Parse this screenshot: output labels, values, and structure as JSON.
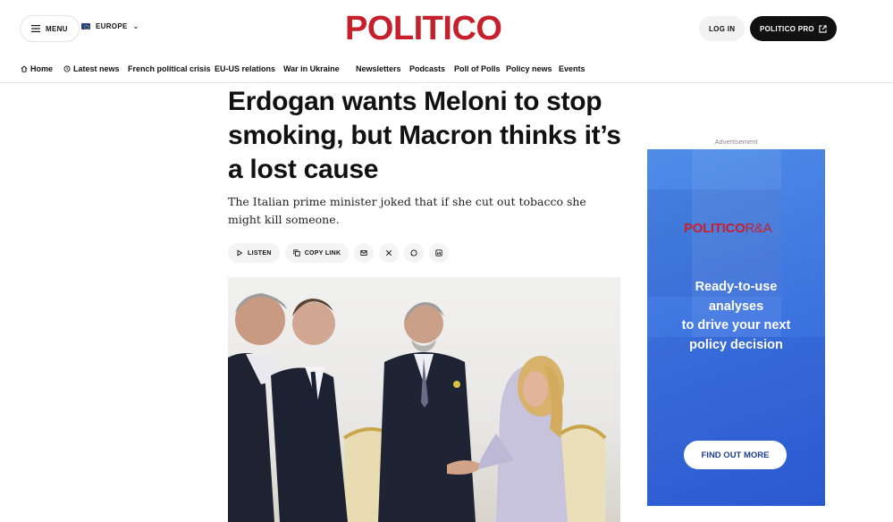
{
  "header": {
    "menu_label": "MENU",
    "region_label": "EUROPE",
    "logo_text": "POLITICO",
    "login_label": "LOG IN",
    "pro_label": "POLITICO PRO",
    "brand_color": "#c6202d"
  },
  "nav": {
    "items": [
      {
        "label": "Home",
        "icon": "home-icon"
      },
      {
        "label": "Latest news",
        "icon": "clock-icon"
      },
      {
        "label": "French political crisis"
      },
      {
        "label": "EU-US relations"
      },
      {
        "label": "War in Ukraine"
      },
      {
        "label": "Newsletters"
      },
      {
        "label": "Podcasts"
      },
      {
        "label": "Poll of Polls"
      },
      {
        "label": "Policy news"
      },
      {
        "label": "Events"
      }
    ]
  },
  "article": {
    "headline": "Erdogan wants Meloni to stop smoking, but Macron thinks it’s a lost cause",
    "dek": "The Italian prime minister joked that if she cut out tobacco she might kill someone.",
    "actions": {
      "listen_label": "LISTEN",
      "copy_link_label": "COPY LINK",
      "share_icons": [
        "mail-icon",
        "x-icon",
        "whatsapp-icon",
        "linkedin-icon"
      ]
    }
  },
  "ad": {
    "label": "Advertisement",
    "logo_main": "POLITICO",
    "logo_suffix": "R&A",
    "copy_lines": [
      "Ready-to-use",
      "analyses",
      "to drive your next",
      "policy decision"
    ],
    "cta_label": "FIND OUT MORE",
    "background_color": "#3f76e0"
  }
}
